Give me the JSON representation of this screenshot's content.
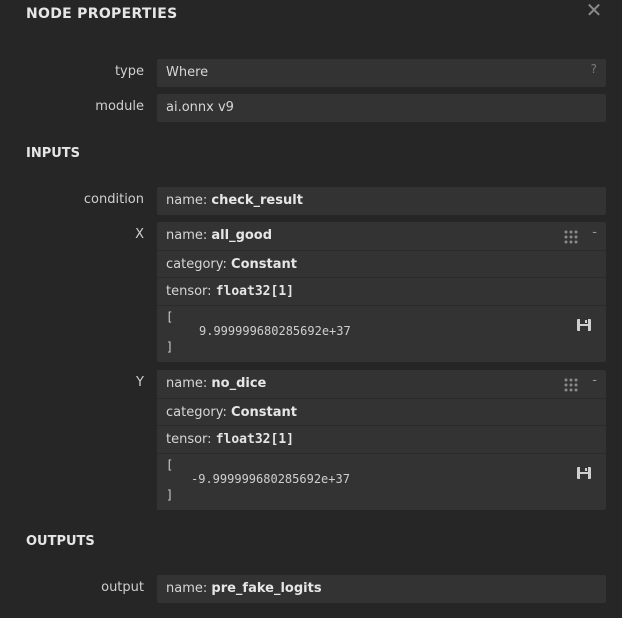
{
  "panel": {
    "title": "NODE PROPERTIES",
    "close_label": "✕"
  },
  "node": {
    "type_label": "type",
    "type_value": "Where",
    "help_label": "?",
    "module_label": "module",
    "module_value": "ai.onnx v9"
  },
  "inputs": {
    "heading": "INPUTS",
    "condition": {
      "label": "condition",
      "name_key": "name: ",
      "name_value": "check_result"
    },
    "x": {
      "label": "X",
      "name_key": "name: ",
      "name_value": "all_good",
      "category_key": "category: ",
      "category_value": "Constant",
      "tensor_key": "tensor: ",
      "tensor_value": "float32[1]",
      "open_bracket": "[",
      "value": "9.999999680285692e+37",
      "close_bracket": "]",
      "toggle": "-"
    },
    "y": {
      "label": "Y",
      "name_key": "name: ",
      "name_value": "no_dice",
      "category_key": "category: ",
      "category_value": "Constant",
      "tensor_key": "tensor: ",
      "tensor_value": "float32[1]",
      "open_bracket": "[",
      "value": "-9.999999680285692e+37",
      "close_bracket": "]",
      "toggle": "-"
    }
  },
  "outputs": {
    "heading": "OUTPUTS",
    "output": {
      "label": "output",
      "name_key": "name: ",
      "name_value": "pre_fake_logits"
    }
  },
  "icons": {
    "close": "close-icon",
    "grip": "grid-dots-icon",
    "save": "save-icon"
  }
}
